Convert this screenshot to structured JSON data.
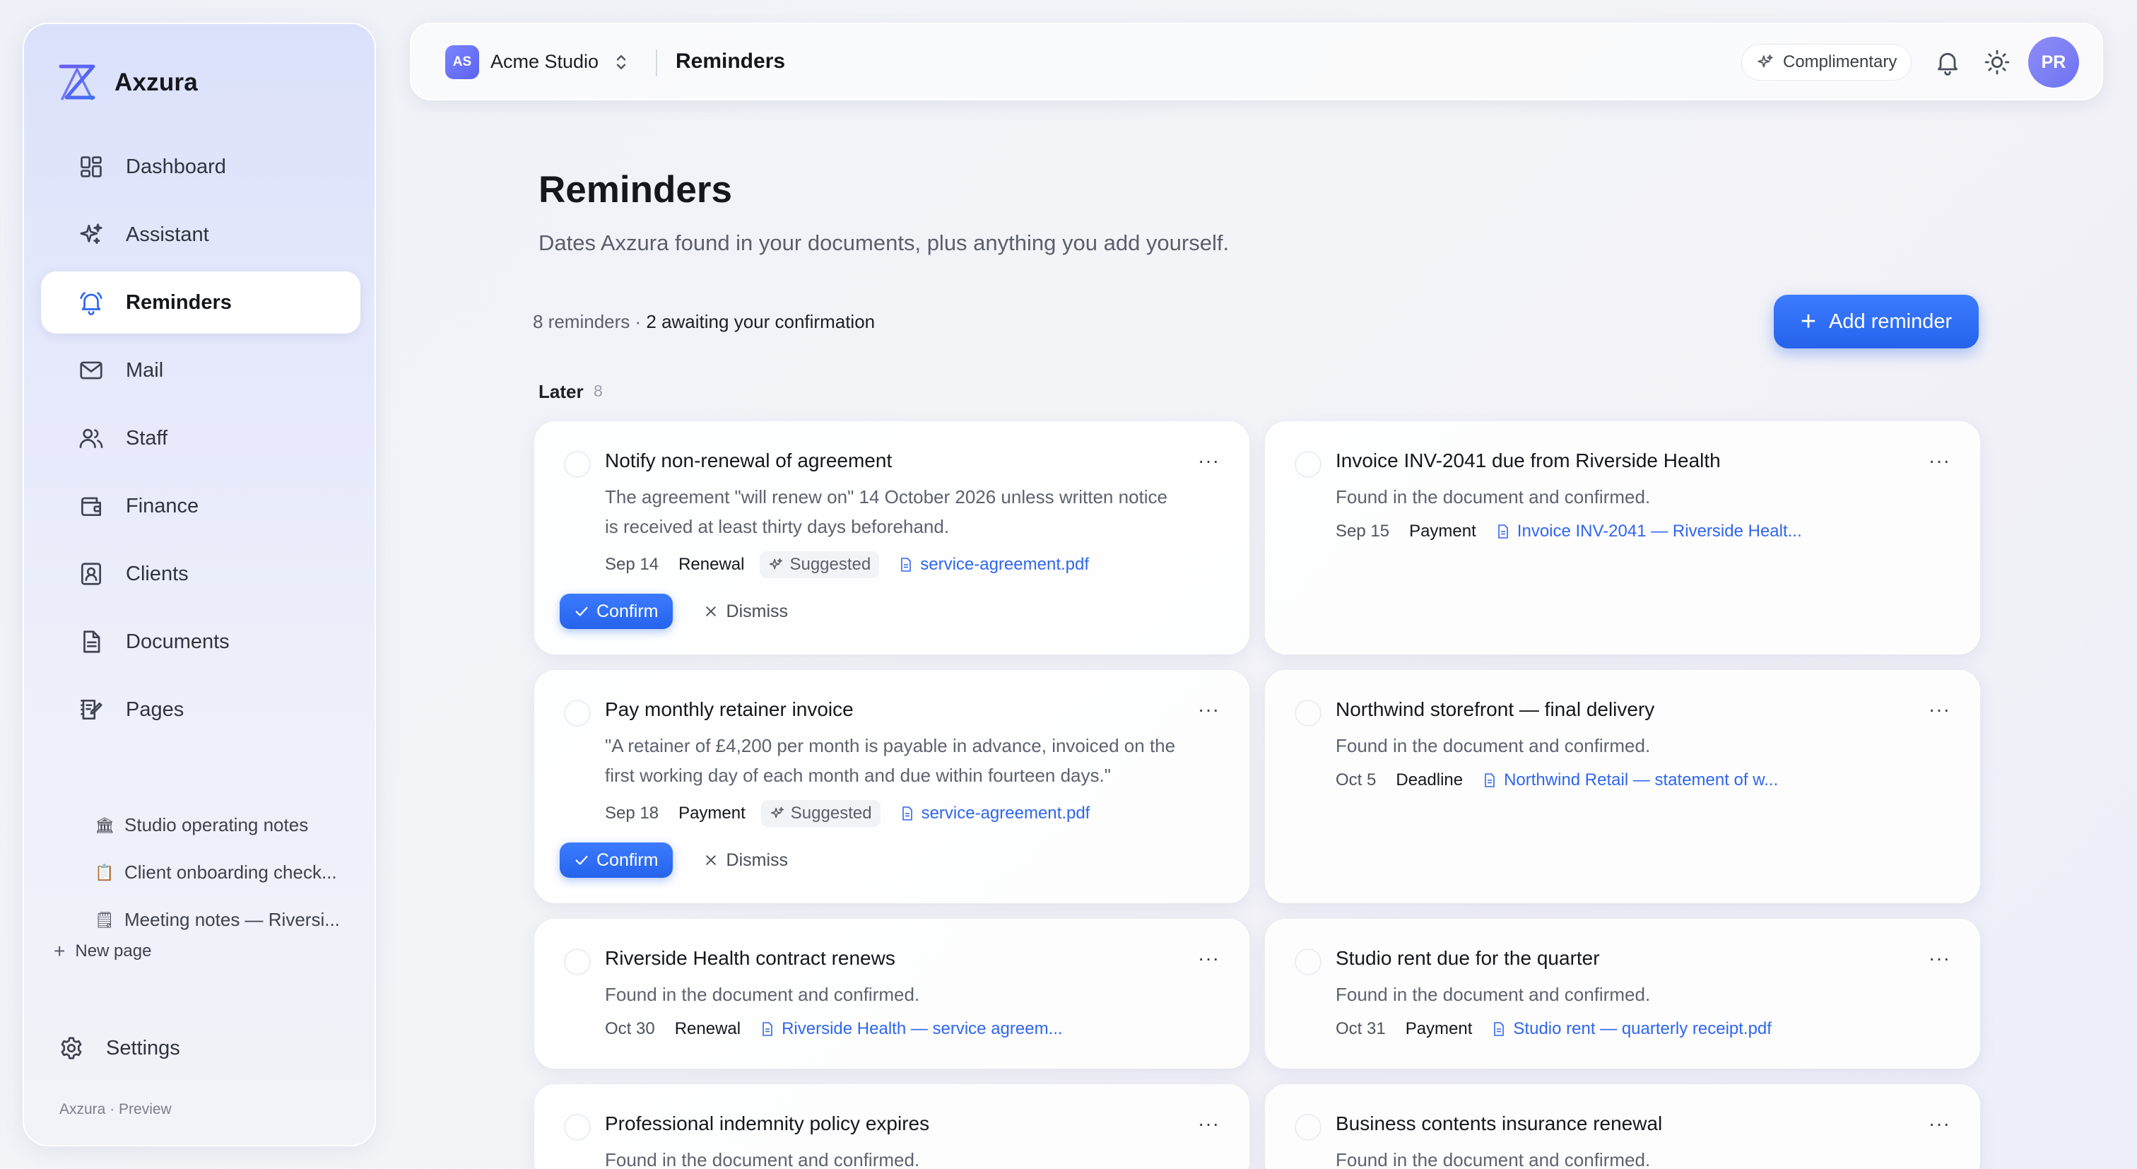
{
  "app": {
    "name": "Axzura",
    "footer": "Axzura · Preview"
  },
  "colors": {
    "accent": "#2f66ee",
    "primary_button": "#2563eb",
    "avatar": "#7c7ff5"
  },
  "sidebar": {
    "items": [
      {
        "label": "Dashboard",
        "icon": "dashboard-icon"
      },
      {
        "label": "Assistant",
        "icon": "sparkles-icon"
      },
      {
        "label": "Reminders",
        "icon": "bell-icon",
        "active": true
      },
      {
        "label": "Mail",
        "icon": "mail-icon"
      },
      {
        "label": "Staff",
        "icon": "users-icon"
      },
      {
        "label": "Finance",
        "icon": "wallet-icon"
      },
      {
        "label": "Clients",
        "icon": "contact-icon"
      },
      {
        "label": "Documents",
        "icon": "document-icon"
      },
      {
        "label": "Pages",
        "icon": "pages-icon"
      }
    ],
    "pages": [
      {
        "emoji": "🏛",
        "label": "Studio operating notes"
      },
      {
        "emoji": "📋",
        "label": "Client onboarding check..."
      },
      {
        "emoji": "🗒",
        "label": "Meeting notes — Riversi..."
      }
    ],
    "new_page": "New page",
    "settings": "Settings"
  },
  "topbar": {
    "workspace_initials": "AS",
    "workspace_name": "Acme Studio",
    "title": "Reminders",
    "plan": "Complimentary",
    "user_initials": "PR"
  },
  "main": {
    "title": "Reminders",
    "subtitle": "Dates Axzura found in your documents, plus anything you add yourself.",
    "summary_count": "8 reminders · ",
    "summary_awaiting": "2 awaiting your confirmation",
    "add_button": "Add reminder",
    "group_label": "Later",
    "group_count": "8",
    "confirm_label": "Confirm",
    "dismiss_label": "Dismiss",
    "suggested_label": "Suggested",
    "more_label": "···"
  },
  "reminders": [
    {
      "title": "Notify non-renewal of agreement",
      "description": "The agreement \"will renew on\" 14 October 2026 unless written notice is received at least thirty days beforehand.",
      "date": "Sep 14",
      "type": "Renewal",
      "suggested": true,
      "document": "service-agreement.pdf"
    },
    {
      "title": "Invoice INV-2041 due from Riverside Health",
      "description": "Found in the document and confirmed.",
      "date": "Sep 15",
      "type": "Payment",
      "suggested": false,
      "document": "Invoice INV-2041 — Riverside Healt..."
    },
    {
      "title": "Pay monthly retainer invoice",
      "description": "\"A retainer of £4,200 per month is payable in advance, invoiced on the first working day of each month and due within fourteen days.\"",
      "date": "Sep 18",
      "type": "Payment",
      "suggested": true,
      "document": "service-agreement.pdf"
    },
    {
      "title": "Northwind storefront — final delivery",
      "description": "Found in the document and confirmed.",
      "date": "Oct 5",
      "type": "Deadline",
      "suggested": false,
      "document": "Northwind Retail — statement of w..."
    },
    {
      "title": "Riverside Health contract renews",
      "description": "Found in the document and confirmed.",
      "date": "Oct 30",
      "type": "Renewal",
      "suggested": false,
      "document": "Riverside Health — service agreem..."
    },
    {
      "title": "Studio rent due for the quarter",
      "description": "Found in the document and confirmed.",
      "date": "Oct 31",
      "type": "Payment",
      "suggested": false,
      "document": "Studio rent — quarterly receipt.pdf"
    },
    {
      "title": "Professional indemnity policy expires",
      "description": "Found in the document and confirmed."
    },
    {
      "title": "Business contents insurance renewal",
      "description": "Found in the document and confirmed."
    }
  ]
}
